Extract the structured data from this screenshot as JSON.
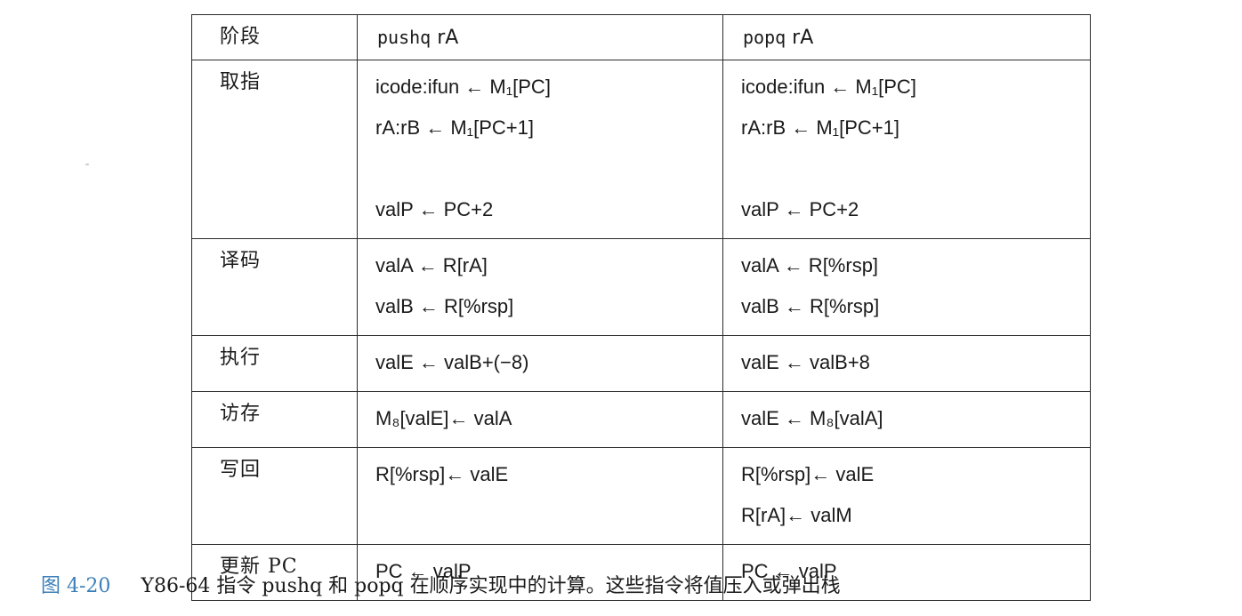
{
  "table": {
    "header": {
      "stage": "阶段",
      "push_prefix": "pushq",
      "push_reg": " rA",
      "pop_prefix": "popq",
      "pop_reg": " rA"
    },
    "rows": [
      {
        "stage": "取指",
        "push": [
          "icode:ifun ← M₁[PC]",
          "rA:rB ← M₁[PC+1]",
          "",
          "valP ← PC+2"
        ],
        "pop": [
          "icode:ifun ← M₁[PC]",
          "rA:rB ← M₁[PC+1]",
          "",
          "valP ← PC+2"
        ]
      },
      {
        "stage": "译码",
        "push": [
          "valA ← R[rA]",
          "valB ← R[%rsp]"
        ],
        "pop": [
          "valA ← R[%rsp]",
          "valB ← R[%rsp]"
        ]
      },
      {
        "stage": "执行",
        "push": [
          "valE ← valB+(−8)"
        ],
        "pop": [
          "valE ← valB+8"
        ]
      },
      {
        "stage": "访存",
        "push": [
          "M₈[valE]← valA"
        ],
        "pop": [
          "valE ← M₈[valA]"
        ]
      },
      {
        "stage": "写回",
        "push": [
          "R[%rsp]← valE"
        ],
        "pop": [
          "R[%rsp]← valE",
          "R[rA]← valM"
        ]
      },
      {
        "stage": "更新 PC",
        "push": [
          "PC ← valP"
        ],
        "pop": [
          "PC ← valP"
        ]
      }
    ]
  },
  "caption": {
    "figure_number": "图 4-20",
    "text": "Y86-64 指令 pushq 和 popq 在顺序实现中的计算。这些指令将值压入或弹出栈"
  }
}
